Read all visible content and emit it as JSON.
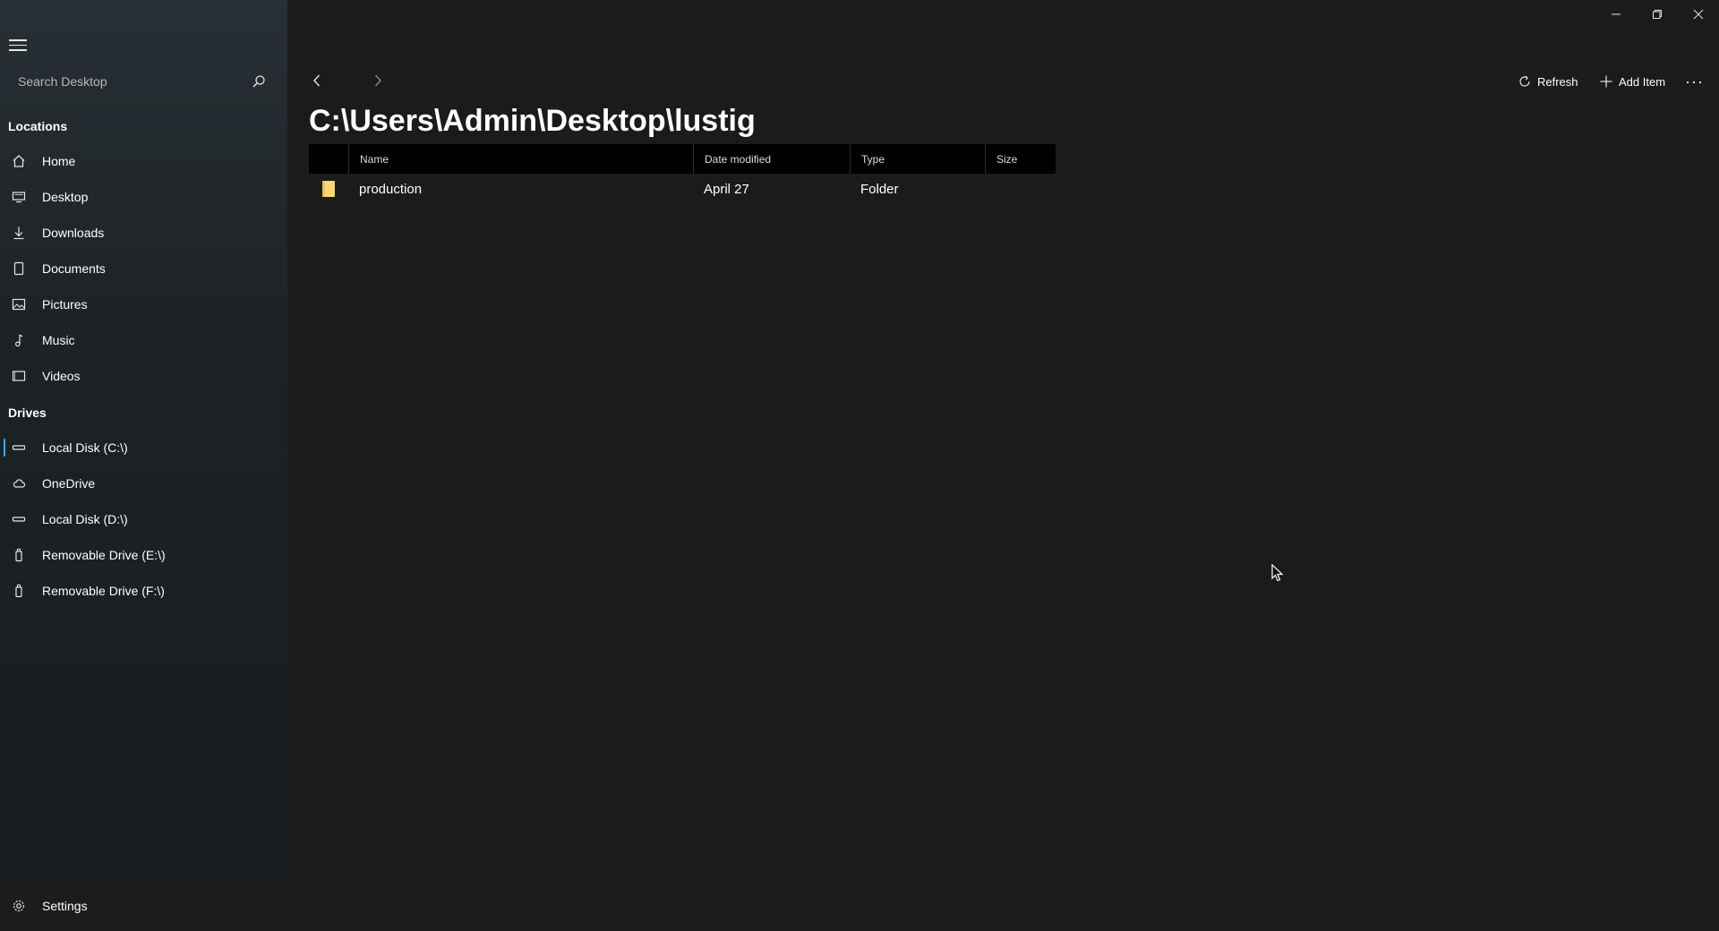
{
  "sidebar": {
    "search_placeholder": "Search Desktop",
    "locations_title": "Locations",
    "locations": [
      {
        "label": "Home",
        "icon": "home-icon"
      },
      {
        "label": "Desktop",
        "icon": "desktop-icon"
      },
      {
        "label": "Downloads",
        "icon": "download-icon"
      },
      {
        "label": "Documents",
        "icon": "document-icon"
      },
      {
        "label": "Pictures",
        "icon": "picture-icon"
      },
      {
        "label": "Music",
        "icon": "music-icon"
      },
      {
        "label": "Videos",
        "icon": "video-icon"
      }
    ],
    "drives_title": "Drives",
    "drives": [
      {
        "label": "Local Disk (C:\\)",
        "icon": "drive-icon",
        "selected": true
      },
      {
        "label": "OneDrive",
        "icon": "cloud-icon"
      },
      {
        "label": "Local Disk (D:\\)",
        "icon": "drive-icon"
      },
      {
        "label": "Removable Drive (E:\\)",
        "icon": "usb-drive-icon"
      },
      {
        "label": "Removable Drive (F:\\)",
        "icon": "usb-drive-icon"
      }
    ],
    "settings_label": "Settings"
  },
  "toolbar": {
    "refresh_label": "Refresh",
    "add_item_label": "Add Item",
    "more_label": "···"
  },
  "path": "C:\\Users\\Admin\\Desktop\\lustig",
  "table": {
    "columns": [
      "Name",
      "Date modified",
      "Type",
      "Size"
    ],
    "rows": [
      {
        "name": "production",
        "date_modified": "April 27",
        "type": "Folder",
        "size": "",
        "icon": "folder-icon"
      }
    ]
  },
  "colors": {
    "accent": "#4ea4e6",
    "folder": "#f8d775",
    "header_bg": "#000000",
    "main_bg": "#1b1b1b"
  }
}
